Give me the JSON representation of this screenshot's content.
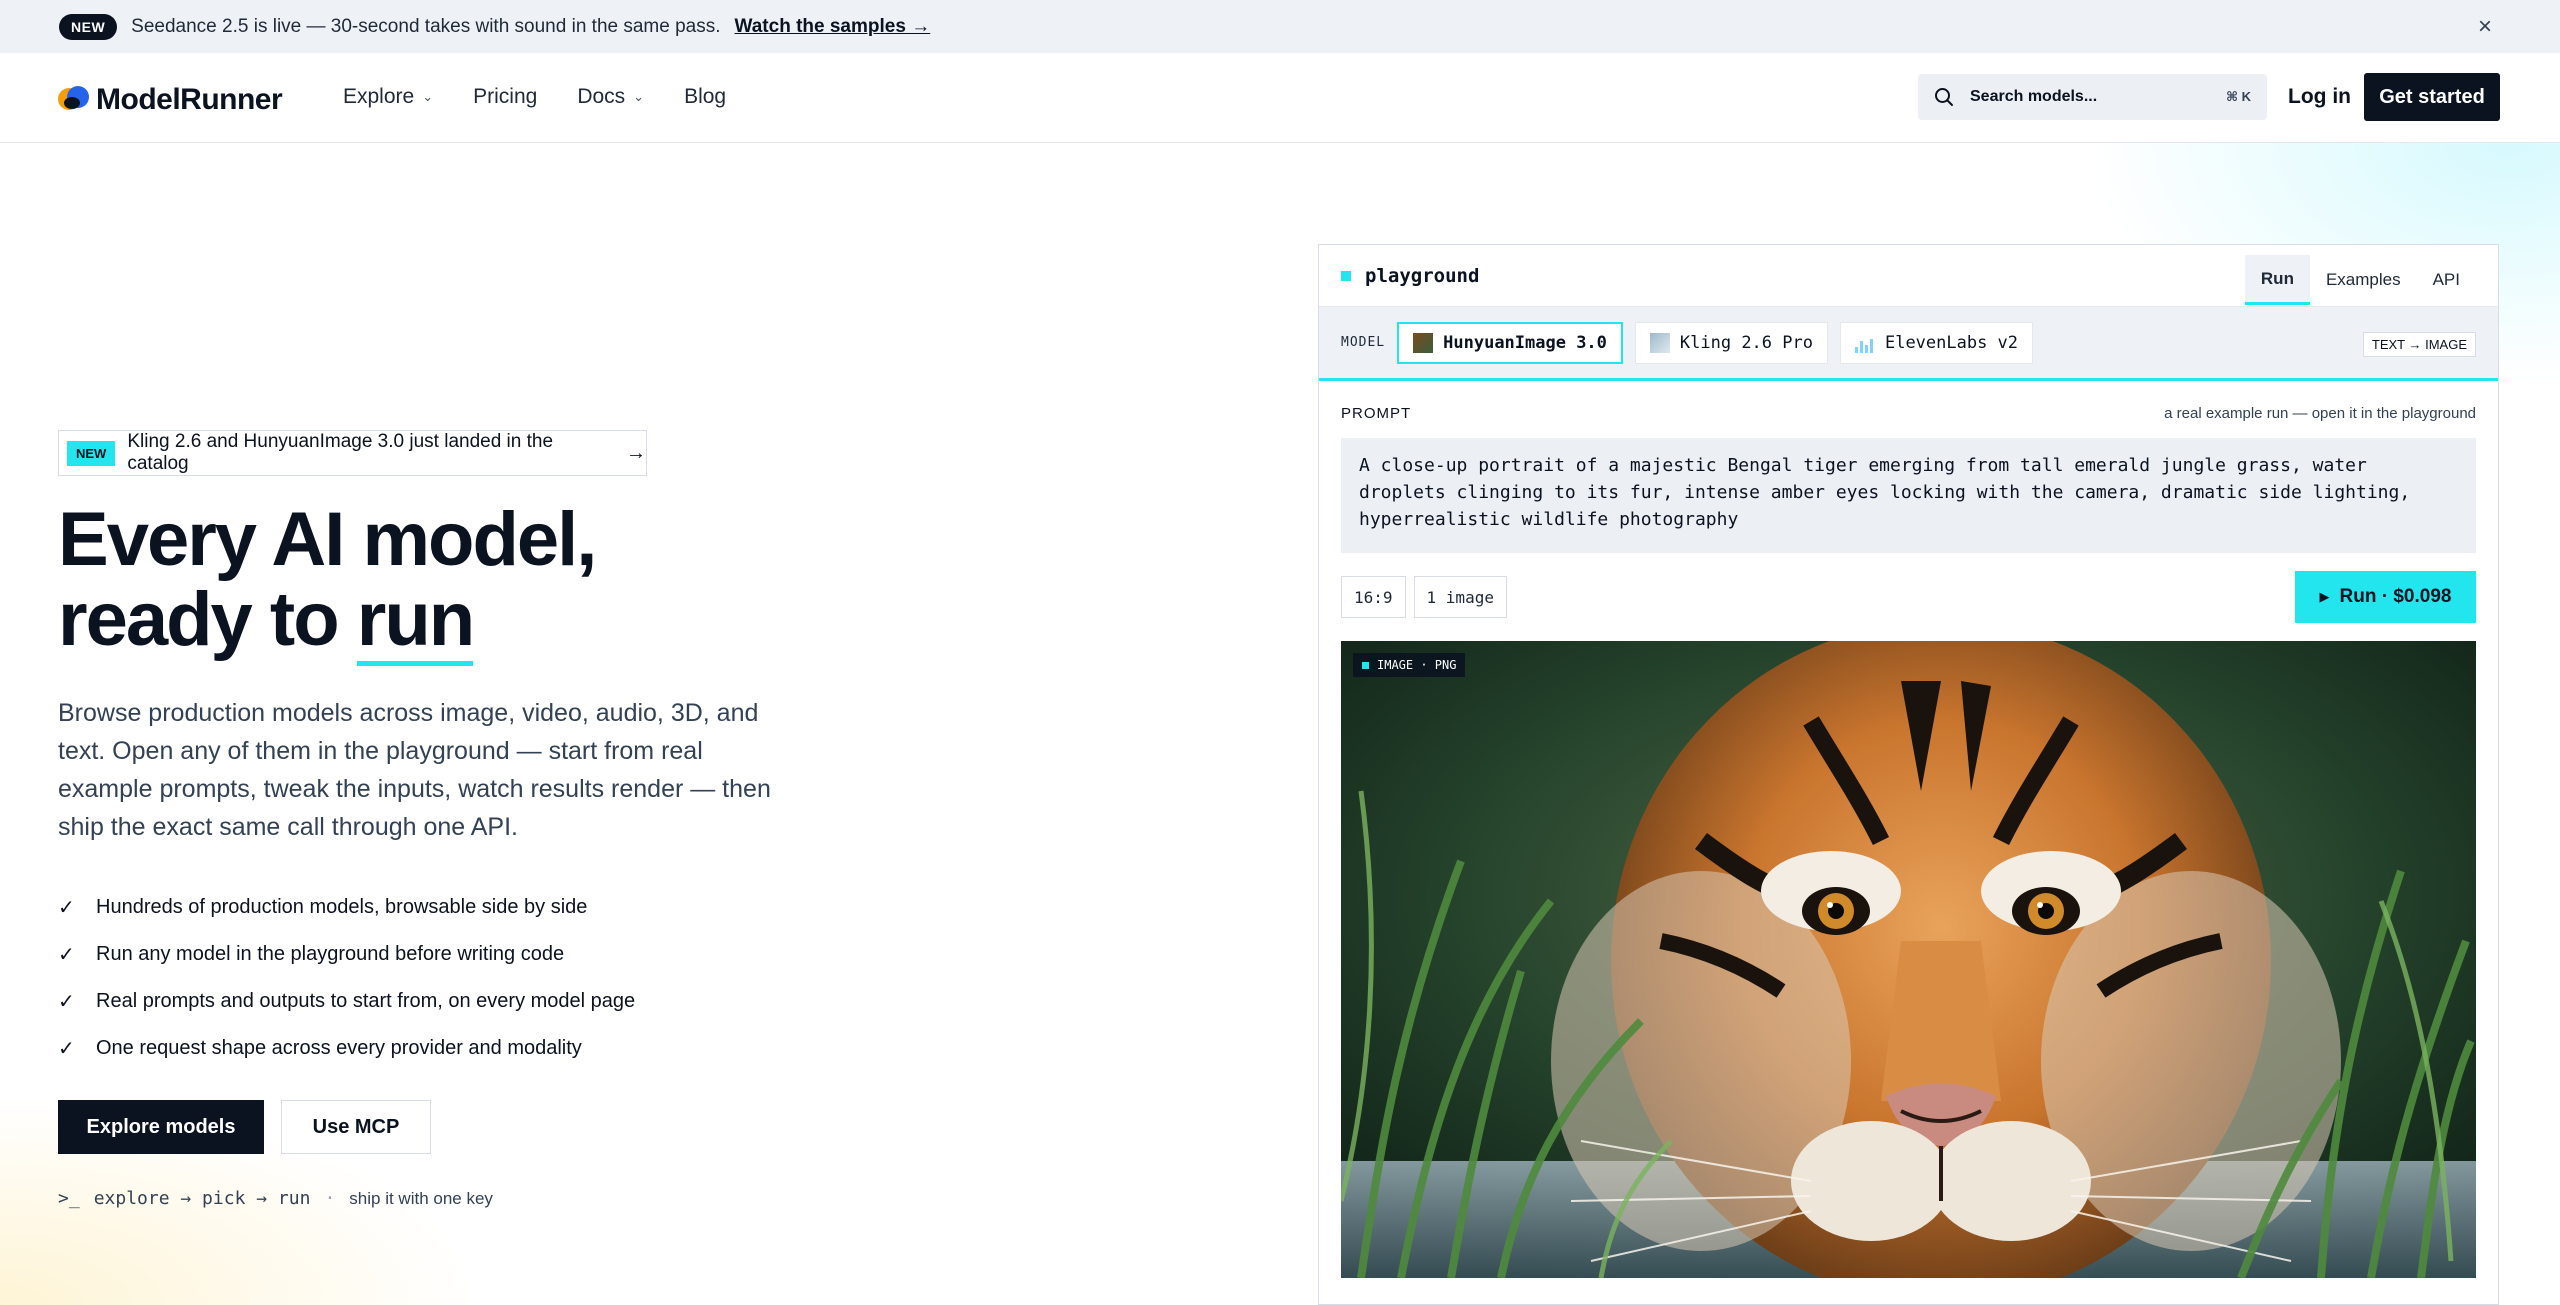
{
  "announcement": {
    "badge": "NEW",
    "text": "Seedance 2.5 is live — 30-second takes with sound in the same pass.",
    "link": "Watch the samples →",
    "close": "×"
  },
  "nav": {
    "brand": "ModelRunner",
    "links": [
      {
        "label": "Explore",
        "has_menu": true
      },
      {
        "label": "Pricing",
        "has_menu": false
      },
      {
        "label": "Docs",
        "has_menu": true
      },
      {
        "label": "Blog",
        "has_menu": false
      }
    ],
    "search_placeholder": "Search models...",
    "search_shortcut": "⌘ K",
    "login": "Log in",
    "cta": "Get started"
  },
  "hero": {
    "badge_new": "NEW",
    "badge_text": "Kling 2.6 and HunyuanImage 3.0 just landed in the catalog",
    "badge_arrow": "→",
    "title_line1": "Every AI model,",
    "title_line2_prefix": "ready to ",
    "title_line2_emph": "run",
    "lede": "Browse production models across image, video, audio, 3D, and text. Open any of them in the playground — start from real example prompts, tweak the inputs, watch results render — then ship the exact same call through one API.",
    "checks": [
      "Hundreds of production models, browsable side by side",
      "Run any model in the playground before writing code",
      "Real prompts and outputs to start from, on every model page",
      "One request shape across every provider and modality"
    ],
    "primary_button": "Explore models",
    "secondary_button": "Use MCP",
    "cli_glyph": ">_",
    "cli_flow": "explore → pick → run",
    "cli_sep": "·",
    "cli_tail": "ship it with one key"
  },
  "playground": {
    "title": "playground",
    "tabs": [
      "Run",
      "Examples",
      "API"
    ],
    "active_tab": "Run",
    "model_label": "MODEL",
    "models": [
      {
        "name": "HunyuanImage 3.0",
        "thumb": "tiger-thumb",
        "active": true
      },
      {
        "name": "Kling 2.6 Pro",
        "thumb": "landscape-thumb",
        "active": false
      },
      {
        "name": "ElevenLabs v2",
        "thumb": "waveform-icon",
        "active": false
      }
    ],
    "mode_tag": "TEXT → IMAGE",
    "prompt_label": "PROMPT",
    "prompt_note": "a real example run — open it in the playground",
    "prompt_text": "A close-up portrait of a majestic Bengal tiger emerging from tall emerald jungle grass, water droplets clinging to its fur, intense amber eyes locking with the camera, dramatic side lighting, hyperrealistic wildlife photography",
    "options": [
      "16:9",
      "1 image"
    ],
    "run_button": "Run · $0.098",
    "output_tag": "IMAGE · PNG"
  },
  "colors": {
    "accent": "#22e5ee",
    "ink": "#0b1220",
    "surface": "#eef1f6"
  }
}
